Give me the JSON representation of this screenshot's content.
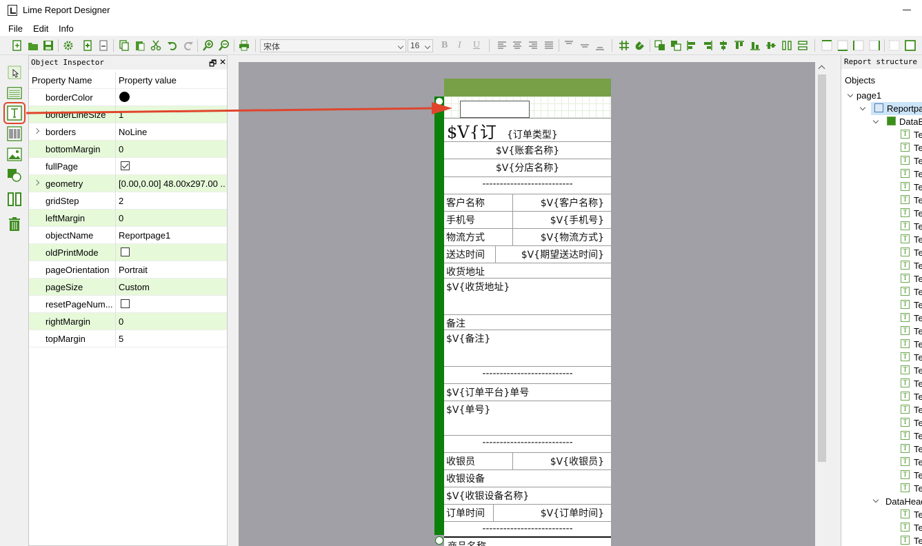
{
  "window": {
    "title": "Lime Report Designer"
  },
  "menu": [
    "File",
    "Edit",
    "Info"
  ],
  "toolbar": {
    "font_name": "宋体",
    "font_size": "16",
    "bold": "B",
    "italic": "I",
    "underline": "U"
  },
  "inspector": {
    "title": "Object Inspector",
    "header": {
      "name": "Property Name",
      "value": "Property value"
    },
    "rows": [
      {
        "name": "borderColor",
        "value": ""
      },
      {
        "name": "borderLineSize",
        "value": "1"
      },
      {
        "name": "borders",
        "value": "NoLine"
      },
      {
        "name": "bottomMargin",
        "value": "0"
      },
      {
        "name": "fullPage",
        "value": ""
      },
      {
        "name": "geometry",
        "value": "[0.00,0.00] 48.00x297.00 ..."
      },
      {
        "name": "gridStep",
        "value": "2"
      },
      {
        "name": "leftMargin",
        "value": "0"
      },
      {
        "name": "objectName",
        "value": "Reportpage1"
      },
      {
        "name": "oldPrintMode",
        "value": ""
      },
      {
        "name": "pageOrientation",
        "value": "Portrait"
      },
      {
        "name": "pageSize",
        "value": "Custom"
      },
      {
        "name": "resetPageNum...",
        "value": ""
      },
      {
        "name": "rightMargin",
        "value": "0"
      },
      {
        "name": "topMargin",
        "value": "5"
      }
    ],
    "checkboxes": {
      "fullPage": true,
      "oldPrintMode": false,
      "resetPageNum": false
    },
    "border_color": "#000000"
  },
  "report": {
    "big_text": "$V{订",
    "order_type": "{订单类型}",
    "account_name": "$V{账套名称}",
    "store_name": "$V{分店名称}",
    "dashes": "--------------------------",
    "customer_label": "客户名称",
    "customer_value": "$V{客户名称}",
    "phone_label": "手机号",
    "phone_value": "$V{手机号}",
    "logistics_label": "物流方式",
    "logistics_value": "$V{物流方式}",
    "delivery_label": "送达时间",
    "delivery_value": "$V{期望送达时间}",
    "address_label": "收货地址",
    "address_value": "$V{收货地址}",
    "remark_label": "备注",
    "remark_value": "$V{备注}",
    "platform_order": "$V{订单平台}单号",
    "order_no": "$V{单号}",
    "cashier_label": "收银员",
    "cashier_value": "$V{收银员}",
    "device_label": "收银设备",
    "device_value": "$V{收银设备名称}",
    "order_time_label": "订单时间",
    "order_time_value": "$V{订单时间}",
    "product_label": "商品名称"
  },
  "structure": {
    "title": "Report structure",
    "objects_label": "Objects",
    "page": "page1",
    "report_page": "Reportpa",
    "databand": "DataB",
    "dataheader": "DataHead",
    "text_item": "Te"
  },
  "colors": {
    "accent_green": "#0b800b",
    "top_margin_band": "#77a047",
    "row_highlight": "#e6f9d9",
    "annotation_red": "#e0452c"
  }
}
